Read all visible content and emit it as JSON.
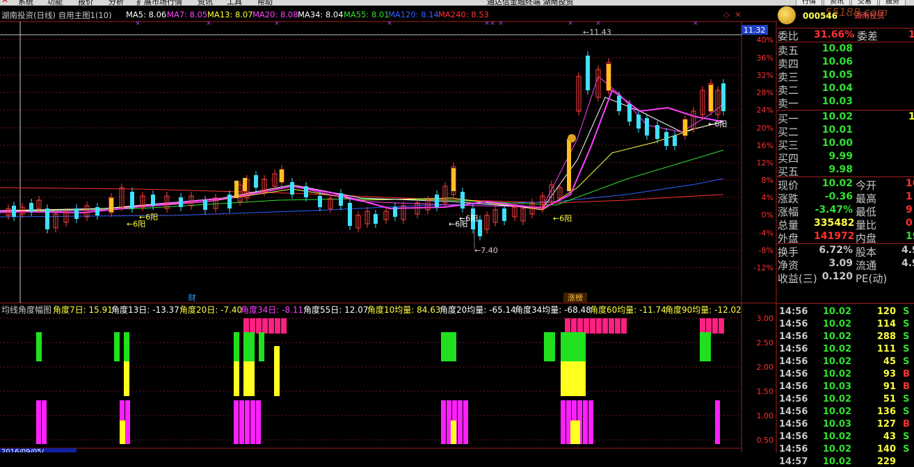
{
  "menubar": {
    "items": [
      "系统",
      "功能",
      "报价",
      "分析",
      "扩展市场行情",
      "资讯",
      "工具",
      "帮助"
    ],
    "center_title": "通达信金融终端   湖南投资",
    "right_buttons": [
      "行情",
      "资讯",
      "交易",
      "服务"
    ]
  },
  "header": {
    "title": "湖南投资(日线) 自用主图1(10)",
    "ma": [
      {
        "label": "MA5: 8.06",
        "color": "#ffffff"
      },
      {
        "label": "MA7: 8.05",
        "color": "#ff40ff"
      },
      {
        "label": "MA13: 8.07",
        "color": "#ffff40"
      },
      {
        "label": "MA20: 8.08",
        "color": "#ff40ff"
      },
      {
        "label": "MA34: 8.04",
        "color": "#ffffff"
      },
      {
        "label": "MA55: 8.01",
        "color": "#30e030"
      },
      {
        "label": "MA120: 8.14",
        "color": "#3060ff"
      },
      {
        "label": "MA240: 8.53",
        "color": "#ff3030"
      }
    ]
  },
  "price_axis": {
    "current_price": "11.32",
    "labels": [
      "40%",
      "36%",
      "32%",
      "28%",
      "24%",
      "20%",
      "16%",
      "12%",
      "8%",
      "4%",
      "0%",
      "-4%",
      "-8%",
      "-12%"
    ],
    "high_mark": "11.43",
    "low_mark": "7.40"
  },
  "annotations": {
    "six_yang": "6阳",
    "cai": "财",
    "zhangbang": "涨榜"
  },
  "indicator": {
    "title": "均线角度幅图",
    "items": [
      {
        "label": "角度7日: 15.91",
        "color": "#ffff40"
      },
      {
        "label": "角度13日: -13.37",
        "color": "#ffffff"
      },
      {
        "label": "角度20日: -7.40",
        "color": "#ffff40"
      },
      {
        "label": "角度34日: -8.11",
        "color": "#ff40ff"
      },
      {
        "label": "角度55日: 12.07",
        "color": "#ffffff"
      },
      {
        "label": "角度10均量: 84.63",
        "color": "#ffff40"
      },
      {
        "label": "角度20均量: -65.14",
        "color": "#ffffff"
      },
      {
        "label": "角度34均量: -68.48",
        "color": "#ffffff"
      },
      {
        "label": "角度60均量: -11.74",
        "color": "#ffff40"
      },
      {
        "label": "角度90均量: -12.02",
        "color": "#ffff40"
      }
    ],
    "axis": [
      "3.00",
      "2.50",
      "2.00",
      "1.50",
      "1.00",
      "0.50"
    ]
  },
  "stock": {
    "code": "000546",
    "name_logo": "湖南投资",
    "watermark": "55188.com",
    "weibi_label": "委比",
    "weibi": "31.66%",
    "weicha_label": "委差",
    "weicha": "1",
    "sell": [
      {
        "label": "卖五",
        "price": "10.08"
      },
      {
        "label": "卖四",
        "price": "10.06"
      },
      {
        "label": "卖三",
        "price": "10.05"
      },
      {
        "label": "卖二",
        "price": "10.04"
      },
      {
        "label": "卖一",
        "price": "10.03"
      }
    ],
    "buy": [
      {
        "label": "买一",
        "price": "10.02",
        "vol": "1"
      },
      {
        "label": "买二",
        "price": "10.01"
      },
      {
        "label": "买三",
        "price": "10.00"
      },
      {
        "label": "买四",
        "price": "9.99"
      },
      {
        "label": "买五",
        "price": "9.98"
      }
    ],
    "stats": [
      {
        "l1": "现价",
        "v1": "10.02",
        "c1": "#30e030",
        "l2": "今开",
        "v2": "10"
      },
      {
        "l1": "涨跌",
        "v1": "-0.36",
        "c1": "#30e030",
        "l2": "最高",
        "v2": "1"
      },
      {
        "l1": "涨幅",
        "v1": "-3.47%",
        "c1": "#30e030",
        "l2": "最低",
        "v2": "9"
      },
      {
        "l1": "总量",
        "v1": "335482",
        "c1": "#ffff40",
        "l2": "量比",
        "v2": "0"
      },
      {
        "l1": "外盘",
        "v1": "141972",
        "c1": "#ff3030",
        "l2": "内盘",
        "v2": "193"
      }
    ],
    "stats2": [
      {
        "l1": "换手",
        "v1": "6.72%",
        "l2": "股本",
        "v2": "4.9"
      },
      {
        "l1": "净资",
        "v1": "3.09",
        "l2": "流通",
        "v2": "4.9"
      },
      {
        "l1": "收益(三)",
        "v1": "0.120",
        "l2": "PE(动)",
        "v2": ""
      }
    ]
  },
  "ticks": [
    {
      "time": "14:56",
      "price": "10.02",
      "vol": "120",
      "bs": "S"
    },
    {
      "time": "14:56",
      "price": "10.02",
      "vol": "114",
      "bs": "S"
    },
    {
      "time": "14:56",
      "price": "10.02",
      "vol": "288",
      "bs": "S"
    },
    {
      "time": "14:56",
      "price": "10.02",
      "vol": "111",
      "bs": "S"
    },
    {
      "time": "14:56",
      "price": "10.02",
      "vol": "45",
      "bs": "S"
    },
    {
      "time": "14:56",
      "price": "10.02",
      "vol": "93",
      "bs": "B"
    },
    {
      "time": "14:56",
      "price": "10.03",
      "vol": "91",
      "bs": "B"
    },
    {
      "time": "14:56",
      "price": "10.02",
      "vol": "51",
      "bs": "S"
    },
    {
      "time": "14:56",
      "price": "10.02",
      "vol": "136",
      "bs": "S"
    },
    {
      "time": "14:56",
      "price": "10.03",
      "vol": "127",
      "bs": "B"
    },
    {
      "time": "14:56",
      "price": "10.02",
      "vol": "43",
      "bs": "S"
    },
    {
      "time": "14:56",
      "price": "10.02",
      "vol": "140",
      "bs": "S"
    },
    {
      "time": "14:57",
      "price": "10.02",
      "vol": "229",
      "bs": ""
    }
  ],
  "footer": {
    "date": "2016/09/05/"
  }
}
